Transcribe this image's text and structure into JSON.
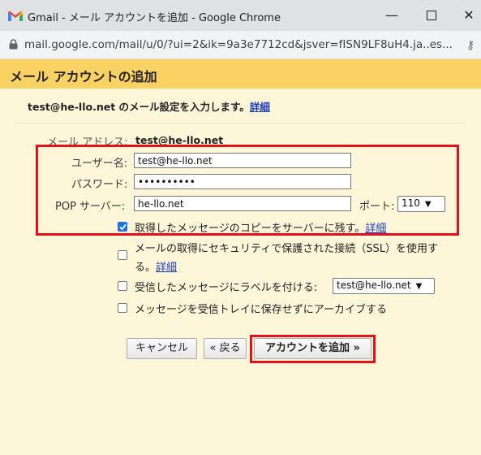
{
  "window": {
    "title": "Gmail - メール アカウントを追加 - Google Chrome",
    "minimize_glyph": "—",
    "close_glyph": "✕",
    "url": "mail.google.com/mail/u/0/?ui=2&ik=9a3e7712cd&jsver=fISN9LF8uH4.ja..es..."
  },
  "header": {
    "title": "メール アカウントの追加"
  },
  "intro": {
    "email": "test@he-llo.net",
    "text": " のメール設定を入力します。",
    "link": "詳細"
  },
  "form": {
    "email_label": "メール アドレス:",
    "email_value": "test@he-llo.net",
    "username_label": "ユーザー名:",
    "username_value": "test@he-llo.net",
    "password_label": "パスワード:",
    "password_value": "••••••••••",
    "pop_label": "POP サーバー:",
    "pop_value": "he-llo.net",
    "port_label": "ポート:",
    "port_value": "110"
  },
  "options": {
    "leave_copy": {
      "text": "取得したメッセージのコピーをサーバーに残す。",
      "link": "詳細",
      "checked": true
    },
    "ssl_line1": "メールの取得にセキュリティで保護された接続（SSL）を使用す",
    "ssl_line2": "る。",
    "ssl_link": "詳細",
    "label_incoming": "受信したメッセージにラベルを付ける:",
    "label_value": "test@he-llo.net",
    "archive": "メッセージを受信トレイに保存せずにアーカイブする"
  },
  "buttons": {
    "cancel": "キャンセル",
    "back": "« 戻る",
    "add": "アカウントを追加 »"
  },
  "colors": {
    "header_bg": "#fad163",
    "page_bg": "#fdf6d9",
    "highlight": "#e5101c",
    "link": "#1a3cc4"
  }
}
